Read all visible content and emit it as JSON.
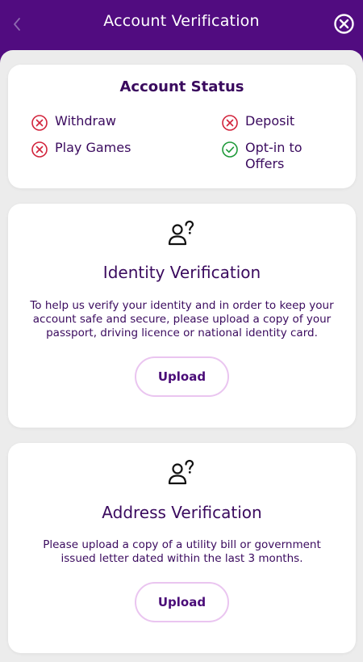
{
  "header": {
    "title": "Account Verification",
    "back_icon": "chevron-left-icon",
    "close_icon": "close-circle-icon"
  },
  "account_status": {
    "title": "Account Status",
    "items": [
      {
        "label": "Withdraw",
        "status": "blocked",
        "icon": "x-circle-icon"
      },
      {
        "label": "Deposit",
        "status": "blocked",
        "icon": "x-circle-icon"
      },
      {
        "label": "Play Games",
        "status": "blocked",
        "icon": "x-circle-icon"
      },
      {
        "label": "Opt-in to Offers",
        "status": "allowed",
        "icon": "check-circle-icon"
      }
    ]
  },
  "identity": {
    "icon": "user-question-icon",
    "title": "Identity Verification",
    "description": "To help us verify your identity and in order to keep your account safe and secure, please upload a copy of your passport, driving licence or national identity card.",
    "button_label": "Upload"
  },
  "address": {
    "icon": "user-question-icon",
    "title": "Address Verification",
    "description": "Please upload a copy of a utility bill or government issued letter dated within the last 3 months.",
    "button_label": "Upload"
  },
  "colors": {
    "brand_purple": "#510c80",
    "text_purple": "#3a0a5e",
    "error_red": "#d2243c",
    "success_green": "#1f9a3a",
    "button_border": "#eac5f0",
    "background": "#ececec"
  }
}
